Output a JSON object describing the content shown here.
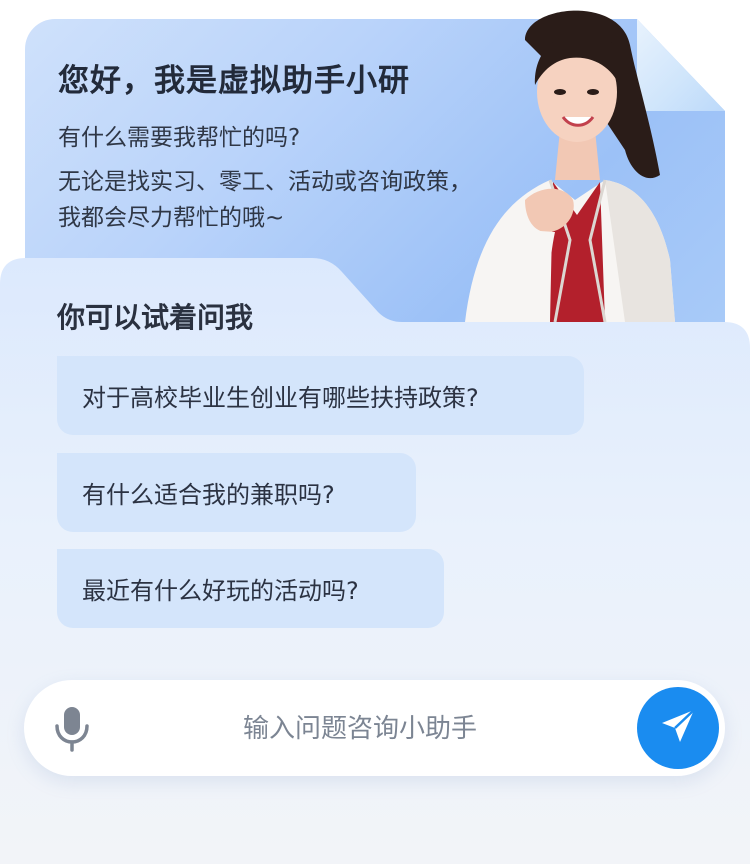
{
  "greeting": {
    "title": "您好，我是虚拟助手小研",
    "subtitle": "有什么需要我帮忙的吗?",
    "description": "无论是找实习、零工、活动或咨询政策，我都会尽力帮忙的哦~"
  },
  "suggestions": {
    "heading": "你可以试着问我",
    "items": [
      {
        "label": "对于高校毕业生创业有哪些扶持政策?"
      },
      {
        "label": "有什么适合我的兼职吗?"
      },
      {
        "label": "最近有什么好玩的活动吗?"
      }
    ]
  },
  "input": {
    "placeholder": "输入问题咨询小助手",
    "value": ""
  },
  "icons": {
    "mic": "microphone-icon",
    "send": "paper-plane-icon"
  },
  "colors": {
    "accent": "#1a8cf0",
    "suggestion_bg": "#d4e5fb"
  }
}
